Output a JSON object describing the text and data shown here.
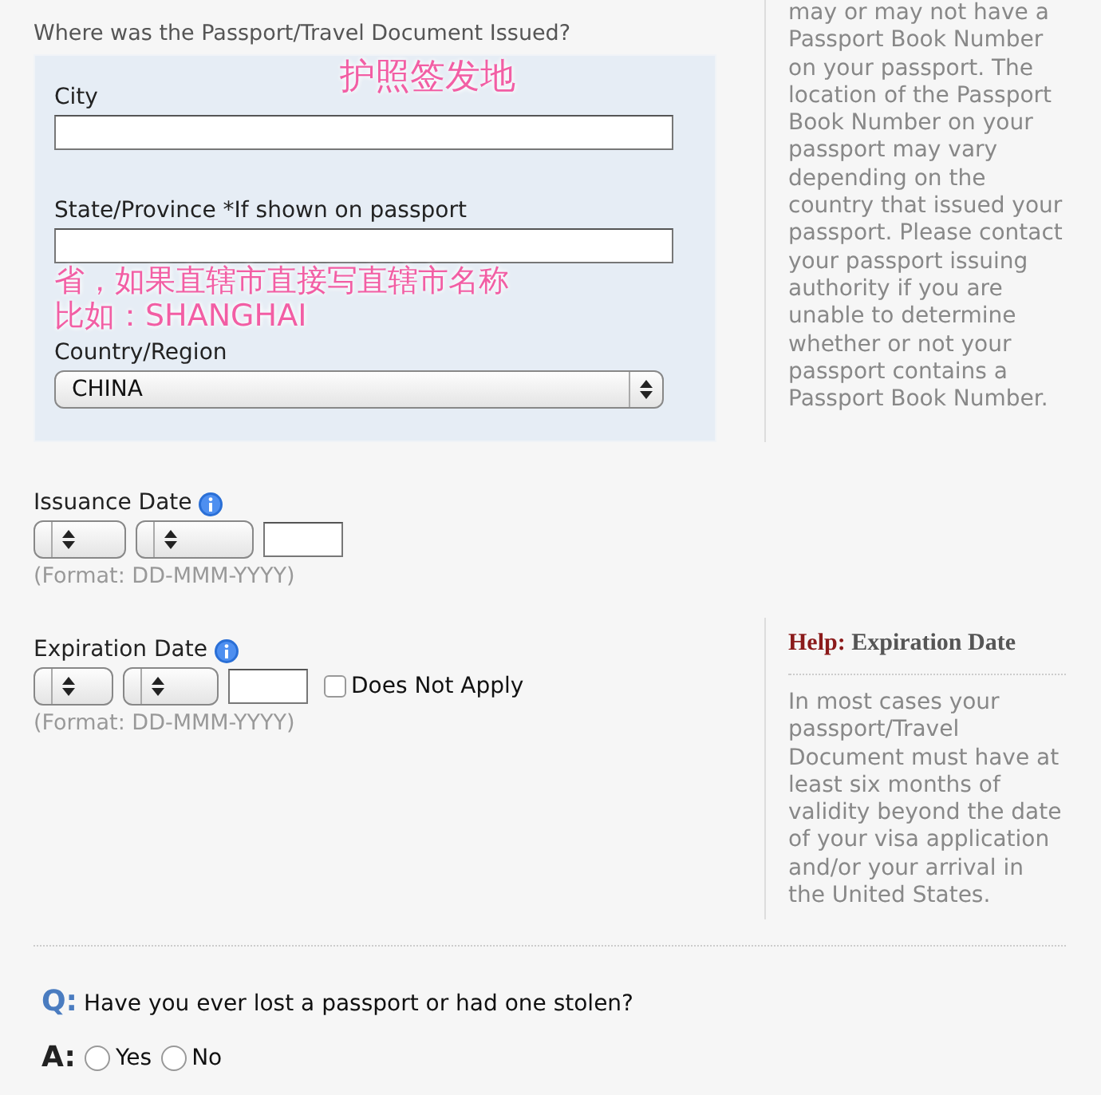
{
  "issued_section": {
    "heading": "Where was the Passport/Travel Document Issued?",
    "annotation": "护照签发地",
    "city": {
      "label": "City"
    },
    "state": {
      "label": "State/Province *If shown on passport",
      "annotation_lines": [
        "省，如果直辖市直接写直辖市名称",
        "比如：SHANGHAI"
      ]
    },
    "country": {
      "label": "Country/Region",
      "value": "CHINA"
    }
  },
  "help_top": {
    "text": "may or may not have a Passport Book Number on your passport. The location of the Passport Book Number on your passport may vary depending on the country that issued your passport. Please contact your passport issuing authority if you are unable to determine whether or not your passport contains a Passport Book Number."
  },
  "issuance_date": {
    "label": "Issuance Date",
    "format": "(Format: DD-MMM-YYYY)"
  },
  "expiration_date": {
    "label": "Expiration Date",
    "format": "(Format: DD-MMM-YYYY)",
    "does_not_apply": {
      "label": "Does Not Apply",
      "checked": false
    }
  },
  "help_expiration": {
    "prefix": "Help:",
    "title": "Expiration Date",
    "text": "In most cases your passport/Travel Document must have at least six months of validity beyond the date of your visa application and/or your arrival in the United States."
  },
  "question": {
    "q_mark": "Q:",
    "text": "Have you ever lost a passport or had one stolen?",
    "a_mark": "A:",
    "options": [
      {
        "label": "Yes",
        "selected": false
      },
      {
        "label": "No",
        "selected": false
      }
    ]
  }
}
